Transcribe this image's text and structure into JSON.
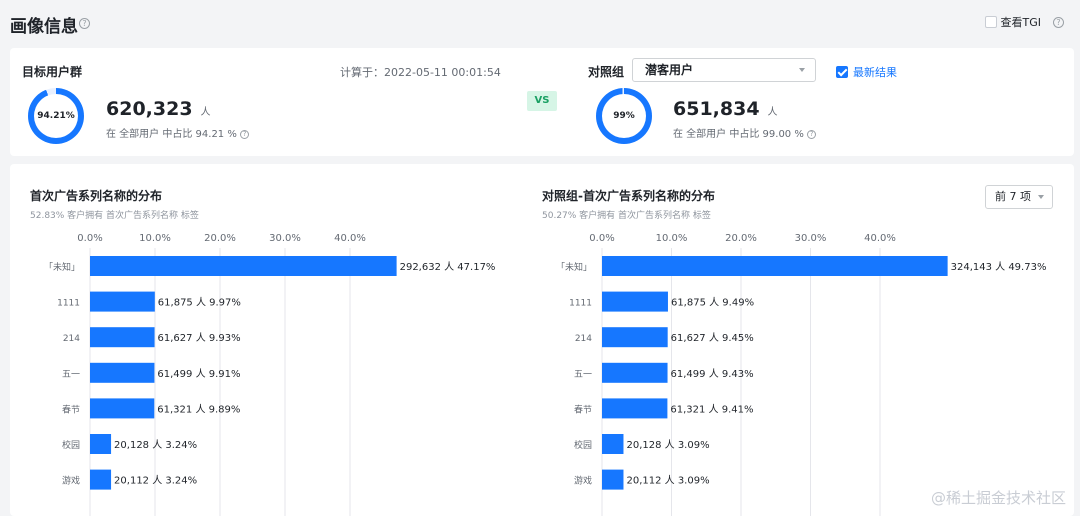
{
  "header": {
    "title": "画像信息",
    "help_glyph": "?",
    "tgi_label": "查看TGI",
    "tgi_help_glyph": "?"
  },
  "compare": {
    "target_title": "目标用户群",
    "calc_time": "计算于：2022-05-11 00:01:54",
    "target": {
      "percent_label": "94.21%",
      "percent_value": 94.21,
      "count": "620,323",
      "unit": "人",
      "share_text": "在 全部用户 中占比 94.21 %"
    },
    "vs_label": "VS",
    "control_label": "对照组",
    "control_select_value": "潜客用户",
    "latest_label": "最新结果",
    "control": {
      "percent_label": "99%",
      "percent_value": 99,
      "count": "651,834",
      "unit": "人",
      "share_text": "在 全部用户 中占比 99.00 %"
    },
    "colors": {
      "ring": "#1677ff",
      "ring_track": "#e8f0ff"
    }
  },
  "distribution": {
    "topn_value": "前 7 项",
    "watermark": "@稀土掘金技术社区"
  },
  "chart_data": [
    {
      "type": "bar",
      "orientation": "horizontal",
      "title": "首次广告系列名称的分布",
      "subtitle": "52.83% 客户拥有 首次广告系列名称 标签",
      "categories": [
        "「未知」",
        "1111",
        "214",
        "五一",
        "春节",
        "校园",
        "游戏"
      ],
      "values": [
        47.17,
        9.97,
        9.93,
        9.91,
        9.89,
        3.24,
        3.24
      ],
      "counts": [
        292632,
        61875,
        61627,
        61499,
        61321,
        20128,
        20112
      ],
      "data_labels": [
        "292,632 人 47.17%",
        "61,875 人 9.97%",
        "61,627 人 9.93%",
        "61,499 人 9.91%",
        "61,321 人 9.89%",
        "20,128 人 3.24%",
        "20,112 人 3.24%"
      ],
      "xticks": [
        "0.0%",
        "10.0%",
        "20.0%",
        "30.0%",
        "40.0%"
      ],
      "xlim": [
        0,
        50
      ],
      "grid": true,
      "color": "#1677ff"
    },
    {
      "type": "bar",
      "orientation": "horizontal",
      "title": "对照组-首次广告系列名称的分布",
      "subtitle": "50.27% 客户拥有 首次广告系列名称 标签",
      "categories": [
        "「未知」",
        "1111",
        "214",
        "五一",
        "春节",
        "校园",
        "游戏"
      ],
      "values": [
        49.73,
        9.49,
        9.45,
        9.43,
        9.41,
        3.09,
        3.09
      ],
      "counts": [
        324143,
        61875,
        61627,
        61499,
        61321,
        20128,
        20112
      ],
      "data_labels": [
        "324,143 人 49.73%",
        "61,875 人 9.49%",
        "61,627 人 9.45%",
        "61,499 人 9.43%",
        "61,321 人 9.41%",
        "20,128 人 3.09%",
        "20,112 人 3.09%"
      ],
      "xticks": [
        "0.0%",
        "10.0%",
        "20.0%",
        "30.0%",
        "40.0%"
      ],
      "xlim": [
        0,
        50
      ],
      "grid": true,
      "color": "#1677ff"
    }
  ]
}
